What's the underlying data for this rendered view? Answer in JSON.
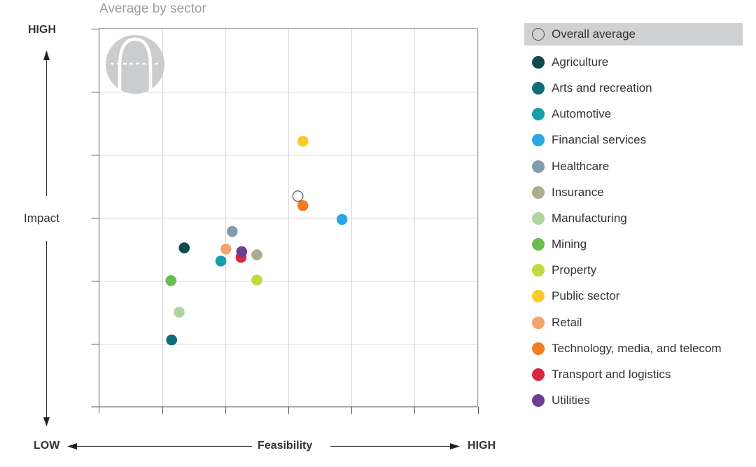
{
  "chart_data": {
    "type": "scatter",
    "title": "Average by sector",
    "xlabel": "Feasibility",
    "ylabel": "Impact",
    "x_low_label": "LOW",
    "x_high_label": "HIGH",
    "y_high_label": "HIGH",
    "xlim": [
      0,
      6
    ],
    "ylim": [
      0,
      6
    ],
    "grid": true,
    "legend_position": "right",
    "series": [
      {
        "name": "Overall average",
        "color": "#ffffff",
        "hollow": true,
        "x": 3.15,
        "y": 3.34
      },
      {
        "name": "Agriculture",
        "color": "#0d4a4f",
        "x": 1.35,
        "y": 2.52
      },
      {
        "name": "Arts and recreation",
        "color": "#0f6d76",
        "x": 1.15,
        "y": 1.06
      },
      {
        "name": "Automotive",
        "color": "#13a0a8",
        "x": 1.93,
        "y": 2.31
      },
      {
        "name": "Financial services",
        "color": "#2aa7e1",
        "x": 3.85,
        "y": 2.97
      },
      {
        "name": "Healthcare",
        "color": "#7f9cb0",
        "x": 2.11,
        "y": 2.78
      },
      {
        "name": "Insurance",
        "color": "#aeac8e",
        "x": 2.5,
        "y": 2.41
      },
      {
        "name": "Manufacturing",
        "color": "#aed69e",
        "x": 1.27,
        "y": 1.5
      },
      {
        "name": "Mining",
        "color": "#6bbd4f",
        "x": 1.14,
        "y": 2.0
      },
      {
        "name": "Property",
        "color": "#c4d940",
        "x": 2.5,
        "y": 2.01
      },
      {
        "name": "Public sector",
        "color": "#fbc92a",
        "x": 3.23,
        "y": 4.21
      },
      {
        "name": "Retail",
        "color": "#f3a36e",
        "x": 2.01,
        "y": 2.5
      },
      {
        "name": "Technology, media, and telecom",
        "color": "#f37c20",
        "x": 3.23,
        "y": 3.19
      },
      {
        "name": "Transport and logistics",
        "color": "#d7263d",
        "x": 2.25,
        "y": 2.37
      },
      {
        "name": "Utilities",
        "color": "#6f3c93",
        "x": 2.26,
        "y": 2.46
      }
    ]
  },
  "icon": "arch-icon",
  "legend_highlighted": "Overall average"
}
